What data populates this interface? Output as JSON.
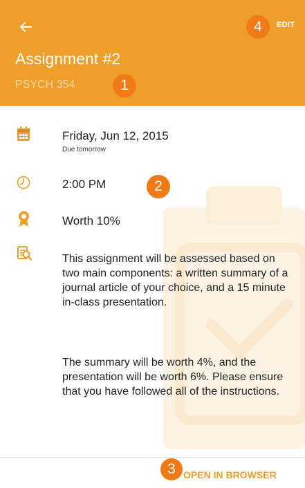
{
  "header": {
    "title": "Assignment #2",
    "course": "PSYCH 354",
    "edit_label": "EDIT",
    "back_icon": "arrow-left-icon"
  },
  "details": {
    "date": "Friday, Jun 12, 2015",
    "date_note": "Due tomorrow",
    "time": "2:00 PM",
    "worth": "Worth 10%",
    "description_paragraph_1": "This assignment will be assessed based on two main components: a written summary of a journal article of your choice, and a 15 minute in-class presentation.",
    "description_paragraph_2": "The summary will be worth 4%, and the presentation will be worth 6%. Please ensure that you have followed all of the instructions."
  },
  "footer": {
    "open_label": "OPEN IN BROWSER"
  },
  "callouts": [
    "1",
    "2",
    "3",
    "4"
  ],
  "colors": {
    "accent": "#EE9F2A",
    "subtitle": "#F8D6A6",
    "callout": "#F07A16"
  }
}
